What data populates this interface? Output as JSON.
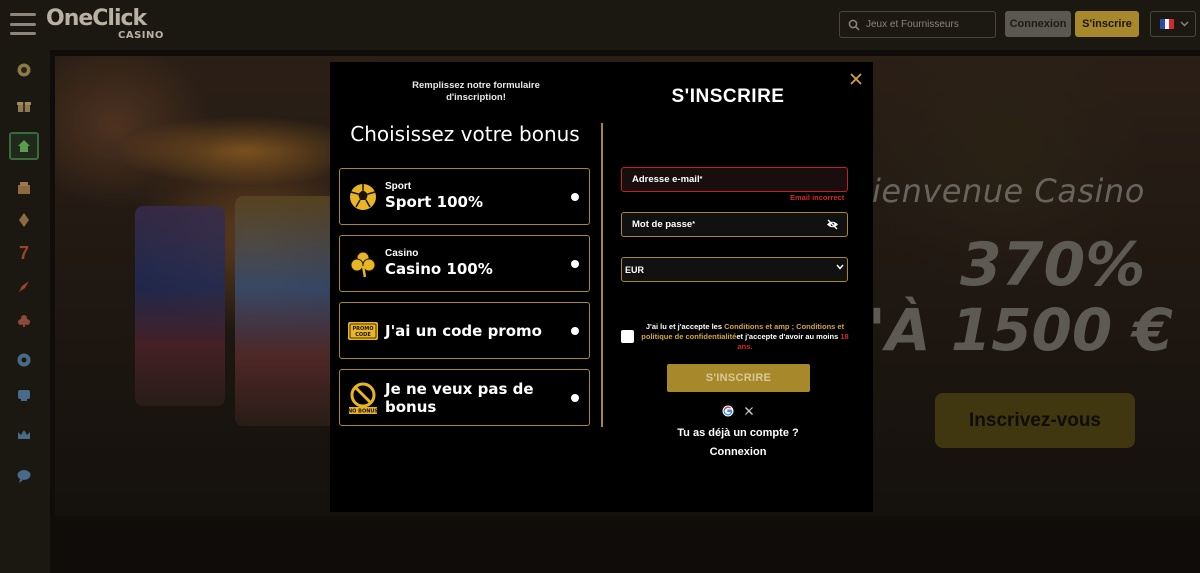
{
  "header": {
    "logo_main": "OneClick",
    "logo_sub": "CASINO",
    "search_placeholder": "Jeux et Fournisseurs",
    "login_label": "Connexion",
    "signup_label": "S'inscrire",
    "language_flag": "fr-flag-icon"
  },
  "sidebar": {
    "items": [
      {
        "icon": "lottery-ball-icon"
      },
      {
        "icon": "gift-icon"
      },
      {
        "icon": "home-icon",
        "active": true
      },
      {
        "icon": "casino-icon"
      },
      {
        "icon": "cards-icon"
      },
      {
        "icon": "seven-slot-icon"
      },
      {
        "icon": "rocket-icon"
      },
      {
        "icon": "poker-icon"
      },
      {
        "icon": "football-icon"
      },
      {
        "icon": "esports-icon"
      },
      {
        "icon": "crown-icon"
      },
      {
        "icon": "chat-icon"
      }
    ]
  },
  "hero": {
    "line1": "ienvenue Casino",
    "line2": "370%",
    "line3": "'À 1500 €",
    "cta": "Inscrivez-vous"
  },
  "modal": {
    "intro": "Remplissez notre formulaire d'inscription!",
    "bonus_heading": "Choisissez votre bonus",
    "bonus_options": [
      {
        "small": "Sport",
        "big": "Sport 100%",
        "icon": "soccer-ball-icon"
      },
      {
        "small": "Casino",
        "big": "Casino 100%",
        "icon": "clover-icon"
      },
      {
        "small": "",
        "big": "J'ai un code promo",
        "icon": "promo-code-icon",
        "icon_text": "PROMO CODE"
      },
      {
        "small": "",
        "big": "Je ne veux pas de bonus",
        "icon": "no-bonus-icon",
        "icon_text": "NO BONUS"
      }
    ],
    "title": "S'INSCRIRE",
    "email_label": "Adresse e-mail",
    "email_error": "Email incorrect",
    "password_label": "Mot de passe",
    "required_mark": "*",
    "currency": "EUR",
    "terms": {
      "part1": "J'ai lu et j'accepte les ",
      "link1": "Conditions et amp ; Conditions et politique de confidentialité",
      "part2": "et j'accepte d'avoir au moins ",
      "age": "18 ans."
    },
    "submit_label": "S'INSCRIRE",
    "already_account": "Tu as déjà un compte ?",
    "login_link": "Connexion"
  },
  "colors": {
    "gold": "#a7882a",
    "error": "#d22a2a",
    "background": "#14110c"
  }
}
